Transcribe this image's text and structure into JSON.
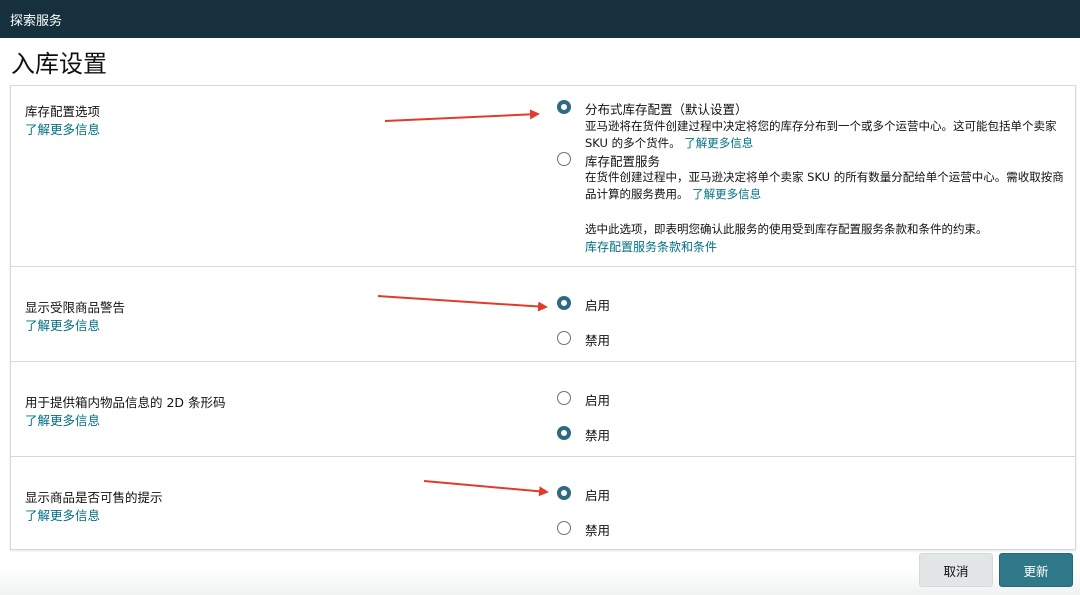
{
  "header": {
    "title": "探索服务"
  },
  "page": {
    "title": "入库设置"
  },
  "sections": [
    {
      "title": "库存配置选项",
      "link": "了解更多信息",
      "options": [
        {
          "label": "分布式库存配置（默认设置）",
          "description": "亚马逊将在货件创建过程中决定将您的库存分布到一个或多个运营中心。这可能包括单个卖家 SKU 的多个货件。",
          "link": "了解更多信息",
          "selected": true
        },
        {
          "label": "库存配置服务",
          "description": "在货件创建过程中，亚马逊决定将单个卖家 SKU 的所有数量分配给单个运营中心。需收取按商品计算的服务费用。",
          "link": "了解更多信息",
          "note": "选中此选项，即表明您确认此服务的使用受到库存配置服务条款和条件的约束。",
          "terms_link": "库存配置服务条款和条件",
          "selected": false
        }
      ]
    },
    {
      "title": "显示受限商品警告",
      "link": "了解更多信息",
      "options": [
        {
          "label": "启用",
          "selected": true
        },
        {
          "label": "禁用",
          "selected": false
        }
      ]
    },
    {
      "title": "用于提供箱内物品信息的 2D 条形码",
      "link": "了解更多信息",
      "options": [
        {
          "label": "启用",
          "selected": false
        },
        {
          "label": "禁用",
          "selected": true
        }
      ]
    },
    {
      "title": "显示商品是否可售的提示",
      "link": "了解更多信息",
      "options": [
        {
          "label": "启用",
          "selected": true
        },
        {
          "label": "禁用",
          "selected": false
        }
      ]
    }
  ],
  "footer": {
    "cancel_label": "取消",
    "update_label": "更新"
  },
  "colors": {
    "header_bg": "#16303d",
    "link": "#007185",
    "radio_selected": "#2e6a80",
    "primary_button": "#2e7889",
    "annotation_arrow": "#e03c2b"
  }
}
